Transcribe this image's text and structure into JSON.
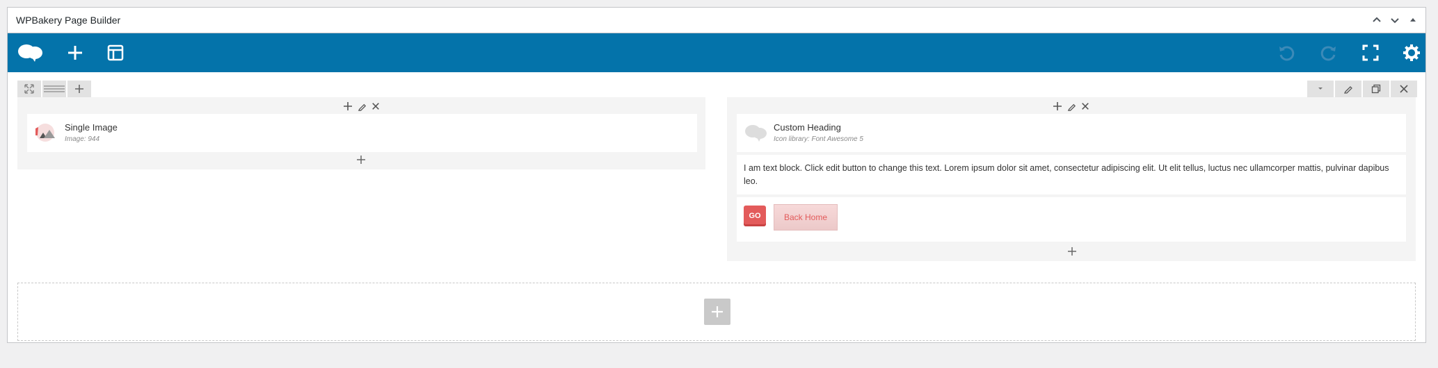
{
  "postbox": {
    "title": "WPBakery Page Builder",
    "controls": [
      "chevron-up-icon",
      "chevron-down-icon",
      "triangle-up-icon"
    ]
  },
  "navbar": {
    "color": "#0473aa",
    "left_buttons": [
      "wpbakery-logo-icon",
      "add-element-icon",
      "templates-icon"
    ],
    "right_buttons": [
      "undo-icon",
      "redo-icon",
      "fullscreen-icon",
      "settings-icon"
    ]
  },
  "row": {
    "left_controls": [
      "move-icon",
      "layout-icon",
      "add-column-icon"
    ],
    "right_controls": [
      "toggle-icon",
      "edit-icon",
      "clone-icon",
      "delete-icon"
    ]
  },
  "left_column": {
    "element": {
      "title": "Single Image",
      "subtitle": "Image: 944",
      "icon": "single-image-icon"
    }
  },
  "right_column": {
    "heading": {
      "title": "Custom Heading",
      "subtitle": "Icon library: Font Awesome 5",
      "icon": "custom-heading-icon"
    },
    "text_block": {
      "text": "I am text block. Click edit button to change this text. Lorem ipsum dolor sit amet, consectetur adipiscing elit. Ut elit tellus, luctus nec ullamcorper mattis, pulvinar dapibus leo."
    },
    "buttons": {
      "go_label": "GO",
      "back_label": "Back Home",
      "accent": "#e35b5b"
    }
  }
}
